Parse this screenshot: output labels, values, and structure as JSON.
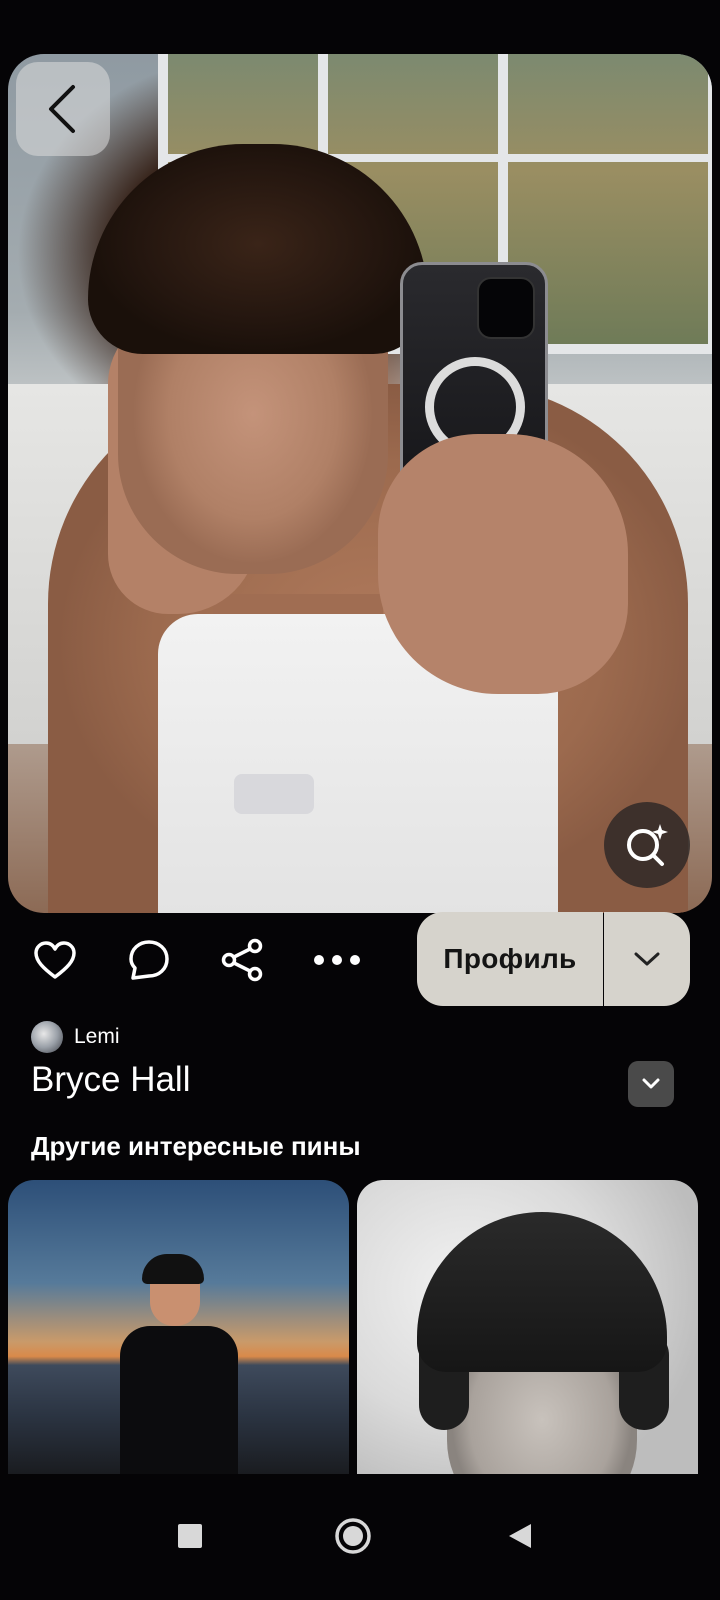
{
  "pin": {
    "title": "Bryce Hall",
    "author": {
      "name": "Lemi"
    }
  },
  "actions": {
    "profile_label": "Профиль"
  },
  "related": {
    "section_title": "Другие интересные пины"
  },
  "icons": {
    "back": "chevron-left-icon",
    "visual_search": "visual-search-icon",
    "like": "heart-icon",
    "comment": "comment-icon",
    "share": "share-icon",
    "more": "more-icon",
    "dropdown": "chevron-down-icon",
    "nav_recents": "square-icon",
    "nav_home": "circle-icon",
    "nav_back": "triangle-back-icon"
  },
  "colors": {
    "background": "#050406",
    "button_fill": "#d6d3cc",
    "text": "#ffffff",
    "dropdown_chip": "#4a4a4a"
  }
}
